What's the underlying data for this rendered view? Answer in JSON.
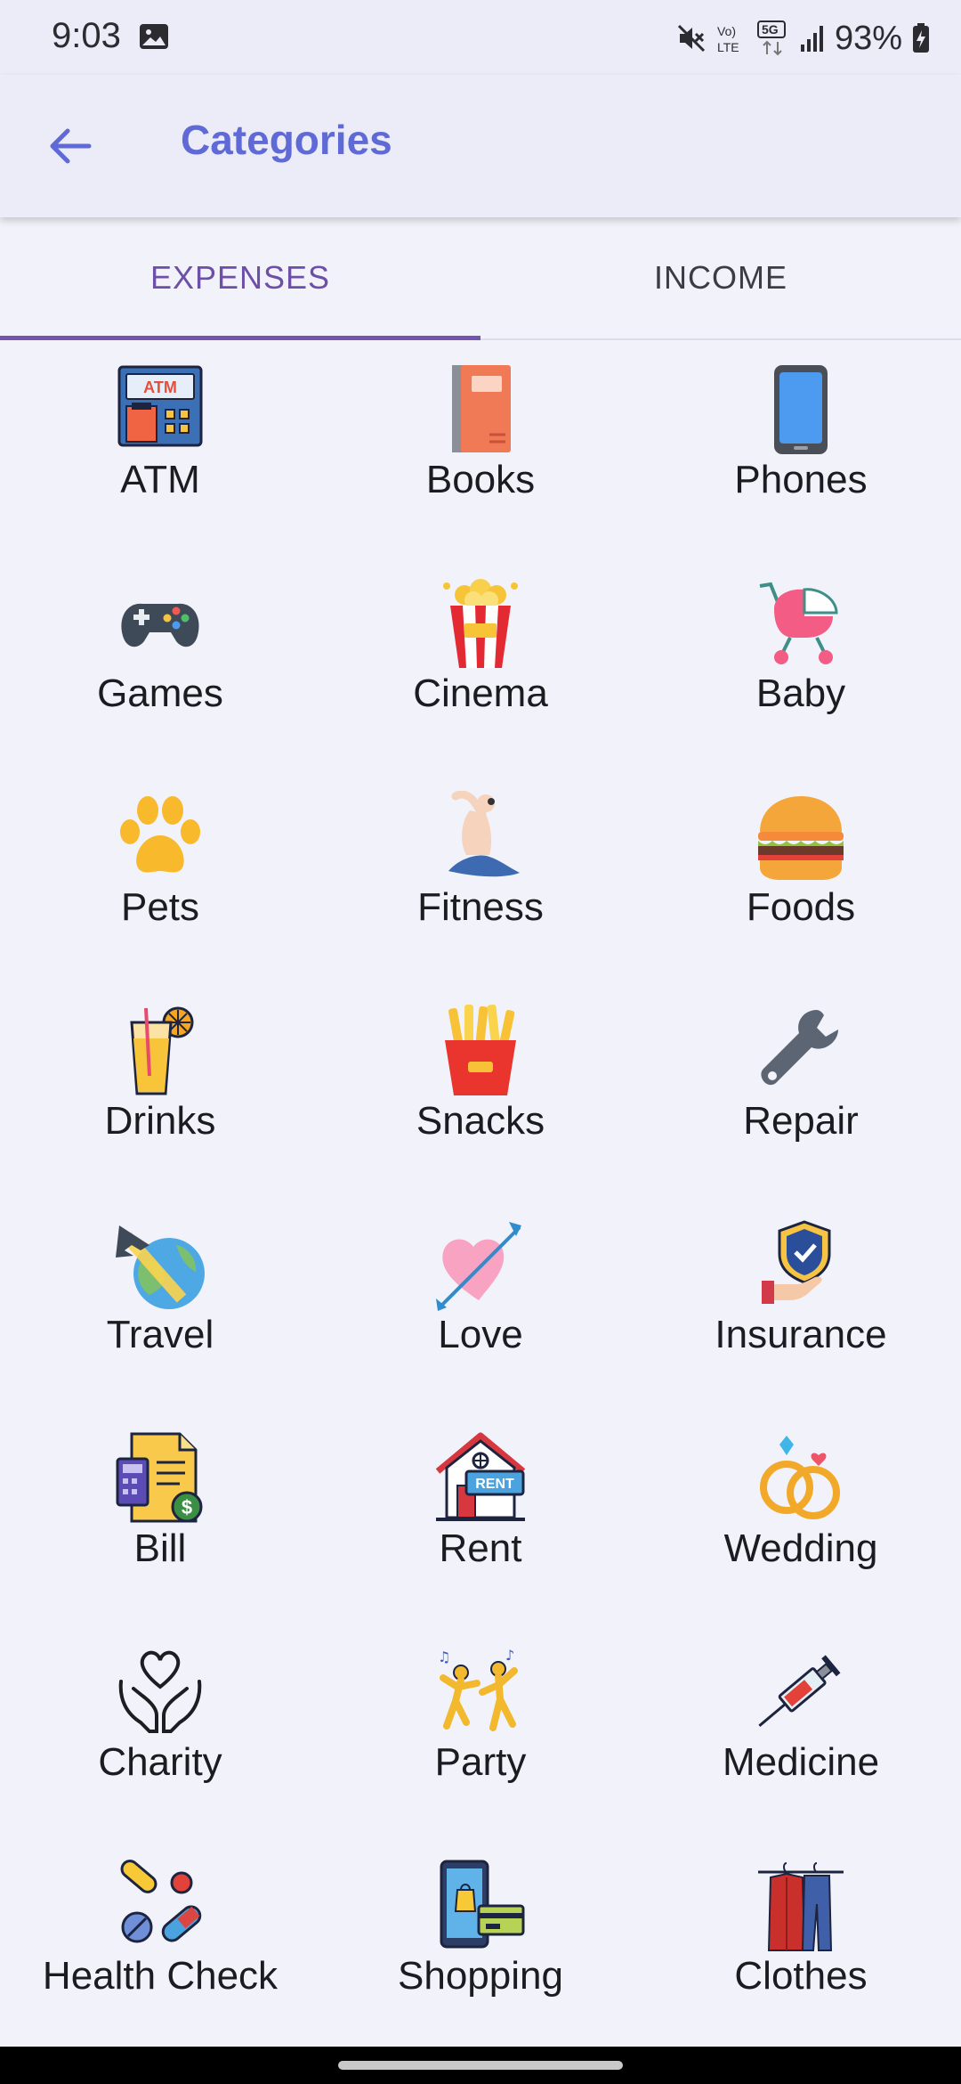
{
  "status_bar": {
    "time": "9:03",
    "battery": "93%"
  },
  "header": {
    "title": "Categories"
  },
  "tabs": [
    {
      "label": "EXPENSES",
      "selected": true
    },
    {
      "label": "INCOME",
      "selected": false
    }
  ],
  "colors": {
    "accent": "#5f6ad6",
    "tab_selected": "#6d4fa8",
    "background": "#f2f3fa"
  },
  "categories": [
    {
      "label": "ATM",
      "icon": "atm-icon"
    },
    {
      "label": "Books",
      "icon": "book-icon"
    },
    {
      "label": "Phones",
      "icon": "phone-icon"
    },
    {
      "label": "Games",
      "icon": "gamepad-icon"
    },
    {
      "label": "Cinema",
      "icon": "popcorn-icon"
    },
    {
      "label": "Baby",
      "icon": "stroller-icon"
    },
    {
      "label": "Pets",
      "icon": "paw-icon"
    },
    {
      "label": "Fitness",
      "icon": "yoga-icon"
    },
    {
      "label": "Foods",
      "icon": "burger-icon"
    },
    {
      "label": "Drinks",
      "icon": "juice-icon"
    },
    {
      "label": "Snacks",
      "icon": "fries-icon"
    },
    {
      "label": "Repair",
      "icon": "wrench-icon"
    },
    {
      "label": "Travel",
      "icon": "airplane-globe-icon"
    },
    {
      "label": "Love",
      "icon": "heart-arrow-icon"
    },
    {
      "label": "Insurance",
      "icon": "shield-hand-icon"
    },
    {
      "label": "Bill",
      "icon": "bill-icon"
    },
    {
      "label": "Rent",
      "icon": "house-rent-icon"
    },
    {
      "label": "Wedding",
      "icon": "rings-icon"
    },
    {
      "label": "Charity",
      "icon": "heart-hands-icon"
    },
    {
      "label": "Party",
      "icon": "dancing-people-icon"
    },
    {
      "label": "Medicine",
      "icon": "syringe-icon"
    },
    {
      "label": "Health Check",
      "icon": "pills-icon"
    },
    {
      "label": "Shopping",
      "icon": "mobile-shopping-icon"
    },
    {
      "label": "Clothes",
      "icon": "clothes-rack-icon"
    }
  ]
}
